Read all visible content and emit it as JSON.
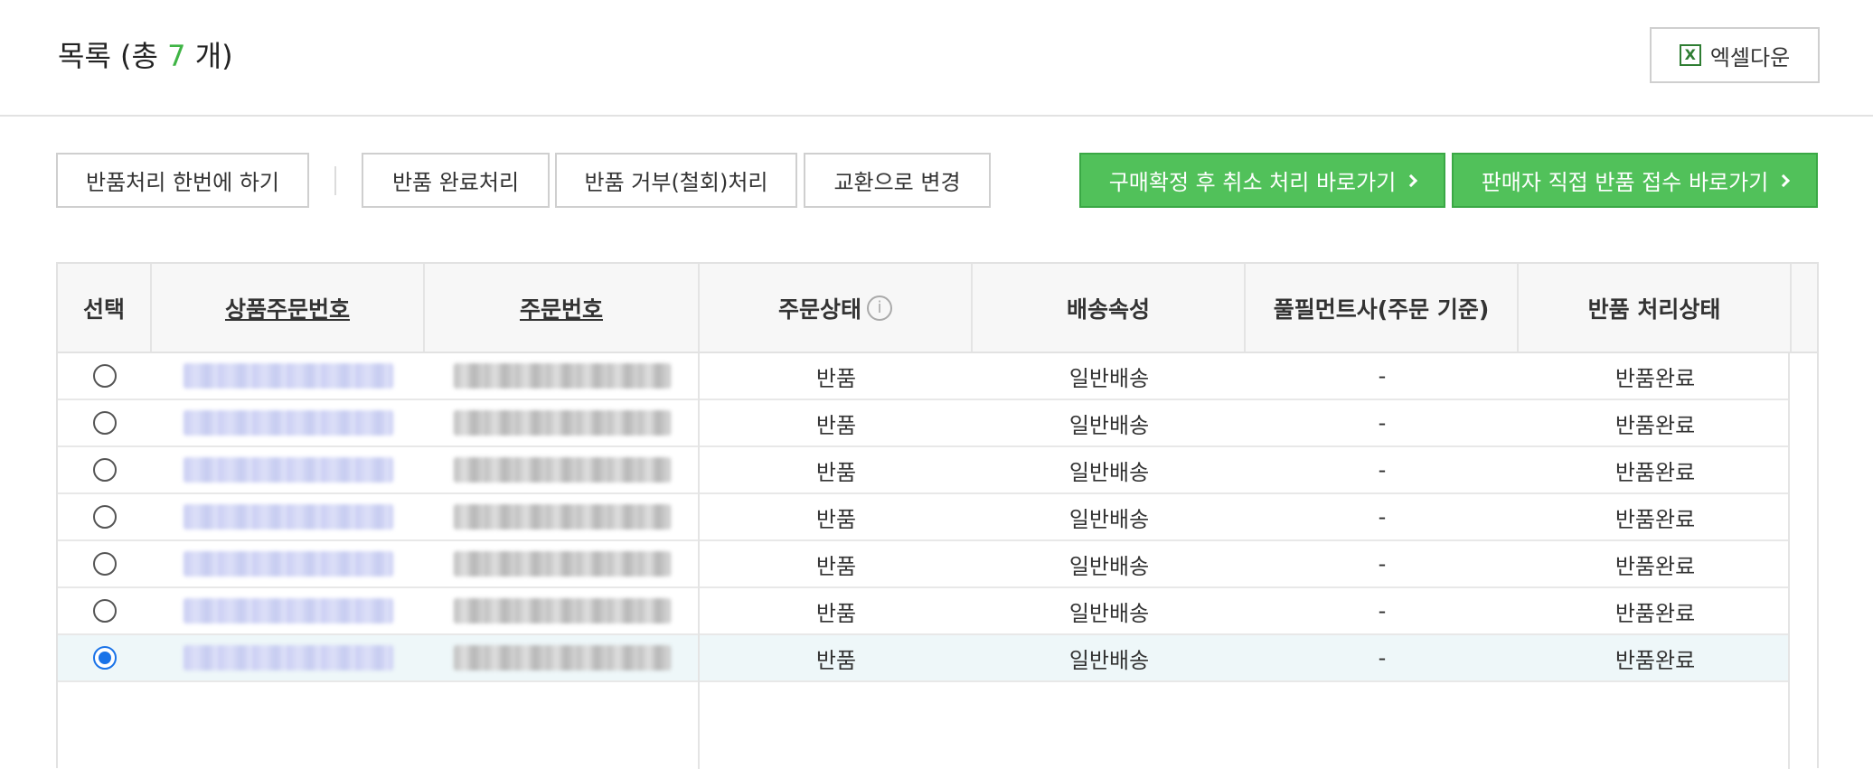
{
  "header": {
    "title_prefix": "목록 (총 ",
    "count": "7",
    "title_suffix": " 개)",
    "excel_label": "엑셀다운",
    "excel_icon": "X"
  },
  "actions": {
    "bulk_return": "반품처리 한번에 하기",
    "complete_return": "반품 완료처리",
    "reject_return": "반품 거부(철회)처리",
    "change_exchange": "교환으로 변경",
    "confirm_cancel": "구매확정 후 취소 처리 바로가기",
    "seller_return": "판매자 직접 반품 접수 바로가기"
  },
  "table": {
    "columns": [
      "선택",
      "상품주문번호",
      "주문번호",
      "주문상태",
      "배송속성",
      "풀필먼트사(주문 기준)",
      "반품 처리상태"
    ],
    "info_icon": "i",
    "rows": [
      {
        "status": "반품",
        "delivery": "일반배송",
        "fulfillment": "-",
        "return_status": "반품완료",
        "selected": false
      },
      {
        "status": "반품",
        "delivery": "일반배송",
        "fulfillment": "-",
        "return_status": "반품완료",
        "selected": false
      },
      {
        "status": "반품",
        "delivery": "일반배송",
        "fulfillment": "-",
        "return_status": "반품완료",
        "selected": false
      },
      {
        "status": "반품",
        "delivery": "일반배송",
        "fulfillment": "-",
        "return_status": "반품완료",
        "selected": false
      },
      {
        "status": "반품",
        "delivery": "일반배송",
        "fulfillment": "-",
        "return_status": "반품완료",
        "selected": false
      },
      {
        "status": "반품",
        "delivery": "일반배송",
        "fulfillment": "-",
        "return_status": "반품완료",
        "selected": false
      },
      {
        "status": "반품",
        "delivery": "일반배송",
        "fulfillment": "-",
        "return_status": "반품완료",
        "selected": true
      }
    ]
  },
  "colors": {
    "accent_green": "#51c15a",
    "count_green": "#3fb445",
    "radio_blue": "#1a73e8",
    "selected_row": "#eef7f9"
  }
}
